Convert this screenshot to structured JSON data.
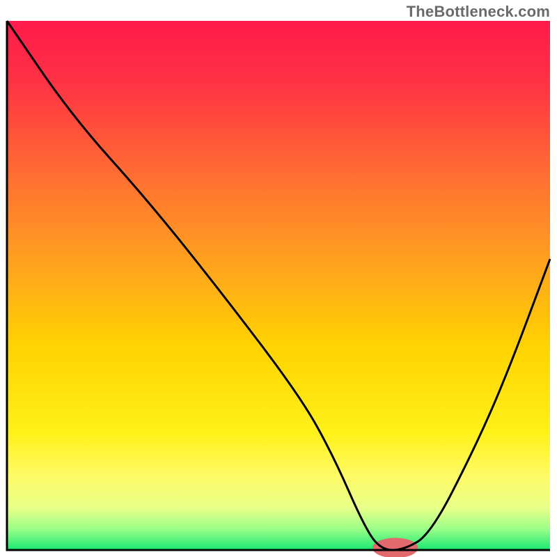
{
  "watermark": "TheBottleneck.com",
  "chart_data": {
    "type": "line",
    "title": "",
    "xlabel": "",
    "ylabel": "",
    "xlim": [
      0,
      100
    ],
    "ylim": [
      0,
      100
    ],
    "x": [
      0,
      12,
      26,
      40,
      54,
      60,
      66,
      69,
      73,
      78,
      86,
      92,
      100
    ],
    "values": [
      100,
      82,
      66,
      48,
      29,
      18,
      4,
      0,
      0,
      3,
      19,
      33,
      55
    ],
    "background_gradient_stops": [
      {
        "offset": 0.0,
        "color": "#ff1a4b"
      },
      {
        "offset": 0.12,
        "color": "#ff3344"
      },
      {
        "offset": 0.28,
        "color": "#ff6a33"
      },
      {
        "offset": 0.45,
        "color": "#ffa01f"
      },
      {
        "offset": 0.62,
        "color": "#ffd400"
      },
      {
        "offset": 0.78,
        "color": "#fff11a"
      },
      {
        "offset": 0.86,
        "color": "#fffb66"
      },
      {
        "offset": 0.92,
        "color": "#e8ff88"
      },
      {
        "offset": 0.96,
        "color": "#9bff88"
      },
      {
        "offset": 1.0,
        "color": "#19e874"
      }
    ],
    "marker": {
      "x": 71.5,
      "y": 0,
      "rx": 4.2,
      "ry": 1.9,
      "color": "#e26a6e"
    },
    "frame_color": "#000000",
    "line_color": "#000000"
  }
}
